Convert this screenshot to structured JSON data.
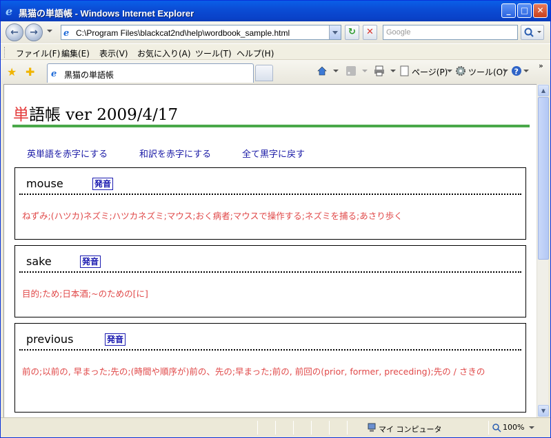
{
  "window": {
    "title": "黒猫の単語帳 - Windows Internet Explorer"
  },
  "address": {
    "url": "C:\\Program Files\\blackcat2nd\\help\\wordbook_sample.html",
    "search_placeholder": "Google"
  },
  "menubar": {
    "items": [
      "ファイル(F)",
      "編集(E)",
      "表示(V)",
      "お気に入り(A)",
      "ツール(T)",
      "ヘルプ(H)"
    ]
  },
  "tab": {
    "label": "黒猫の単語帳"
  },
  "commandbar": {
    "page": "ページ(P)",
    "tools": "ツール(O)"
  },
  "page": {
    "title_first": "単",
    "title_rest": "語帳 ver 2009/4/17",
    "links": [
      "英単語を赤字にする",
      "和訳を赤字にする",
      "全て黒字に戻す"
    ],
    "pron_label": "発音",
    "cards": [
      {
        "word": "mouse",
        "meaning": "ねずみ;(ハツカ)ネズミ;ハツカネズミ;マウス;おく病者;マウスで操作する;ネズミを捕る;あさり歩く"
      },
      {
        "word": "sake",
        "meaning": "目的;ため;日本酒;~のための[に]"
      },
      {
        "word": "previous",
        "meaning": "前の;以前の, 早まった;先の;(時間や順序が)前の、先の;早まった;前の, 前回の(prior, former, preceding);先の / さきの"
      }
    ]
  },
  "status": {
    "zone": "マイ コンピュータ",
    "zoom": "100%"
  }
}
